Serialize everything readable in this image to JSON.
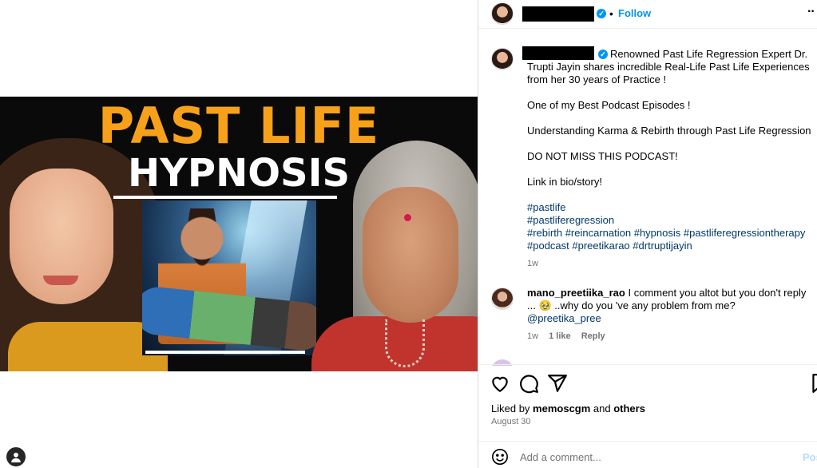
{
  "thumbnail": {
    "title": "PAST LIFE",
    "subtitle": "HYPNOSIS",
    "colors": {
      "title": "#f7a11a",
      "subtitle": "#ffffff"
    }
  },
  "header": {
    "follow_label": "Follow",
    "separator": "•",
    "more_icon": "more-horizontal-icon"
  },
  "caption": {
    "paragraphs": [
      "Renowned Past Life Regression Expert Dr. Trupti Jayin shares incredible Real-Life Past Life Experiences from her 30 years of Practice !",
      "One of my Best Podcast Episodes !",
      "Understanding Karma & Rebirth through Past Life Regression",
      "DO NOT MISS THIS PODCAST!",
      "Link in bio/story!"
    ],
    "hashtags": {
      "line1": [
        "#pastlife"
      ],
      "line2": [
        "#pastliferegression"
      ],
      "line3": [
        "#rebirth",
        "#reincarnation",
        "#hypnosis",
        "#pastliferegressiontherapy"
      ],
      "line4": [
        "#podcast",
        "#preetikarao",
        "#drtruptijayin"
      ]
    },
    "time": "1w"
  },
  "comment": {
    "username": "mano_preetiika_rao",
    "text_part1": "I comment you altot but you don't reply ... ",
    "emoji": "🥹",
    "text_part2": " ..why do you 've any problem from me?",
    "mention": "@preetika_pree",
    "time": "1w",
    "likes": "1 like",
    "reply_label": "Reply"
  },
  "actions": {
    "icons": [
      "heart-icon",
      "comment-icon",
      "share-icon",
      "bookmark-icon"
    ]
  },
  "likes": {
    "prefix": "Liked by ",
    "user": "memoscgm",
    "middle": " and ",
    "others": "others"
  },
  "date": "August 30",
  "add_comment": {
    "placeholder": "Add a comment...",
    "post_label": "Post"
  },
  "colors": {
    "accent": "#0095f6",
    "link": "#00376b",
    "muted": "#737373"
  }
}
